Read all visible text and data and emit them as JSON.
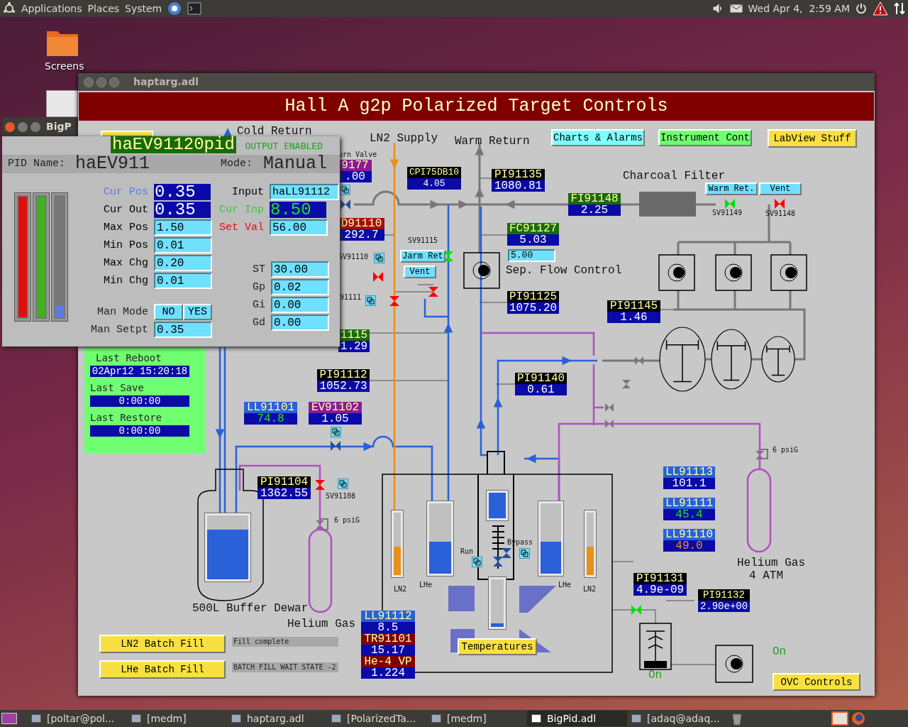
{
  "top_panel": {
    "menus": [
      "Applications",
      "Places",
      "System"
    ],
    "clock": "Wed Apr 4,  2:59 AM"
  },
  "desktop_icons": [
    {
      "label": "Screens"
    }
  ],
  "main_window": {
    "title": "haptarg.adl",
    "banner": "Hall A g2p Polarized Target Controls",
    "nav_buttons": [
      {
        "label": "Charts & Alarms",
        "color": "#80ffff"
      },
      {
        "label": "Instrument Cont",
        "color": "#70ff70"
      },
      {
        "label": "LabView Stuff",
        "color": "#f8e040"
      }
    ],
    "labels": [
      {
        "text": "Cold Return",
        "kind": "caption"
      },
      {
        "text": "LN2 Supply",
        "kind": "caption"
      },
      {
        "text": "Warm Return",
        "kind": "caption"
      },
      {
        "text": "Charcoal Filter",
        "kind": "caption"
      },
      {
        "text": "urn Valve",
        "kind": "tag"
      },
      {
        "text": "SV91115",
        "kind": "tag"
      },
      {
        "text": "SV91110",
        "kind": "tag"
      },
      {
        "text": "91111",
        "kind": "tag"
      },
      {
        "text": "Sep. Flow Control",
        "kind": "caption"
      },
      {
        "text": "SV91149",
        "kind": "tag"
      },
      {
        "text": "SV91148",
        "kind": "tag"
      },
      {
        "text": "SV91108",
        "kind": "tag"
      },
      {
        "text": "6 psiG",
        "kind": "tag"
      },
      {
        "text": "6 psiG",
        "kind": "tag"
      },
      {
        "text": "500L Buffer Dewar",
        "kind": "caption"
      },
      {
        "text": "Helium Gas",
        "kind": "caption"
      },
      {
        "text": "Run",
        "kind": "tag"
      },
      {
        "text": "Bypass",
        "kind": "tag"
      },
      {
        "text": "LN2",
        "kind": "tag"
      },
      {
        "text": "LHe",
        "kind": "tag"
      },
      {
        "text": "LHe",
        "kind": "tag"
      },
      {
        "text": "LN2",
        "kind": "tag"
      },
      {
        "text": "Helium Gas",
        "kind": "caption"
      },
      {
        "text": "4 ATM",
        "kind": "caption"
      },
      {
        "text": "On",
        "kind": "status"
      },
      {
        "text": "On",
        "kind": "status"
      }
    ],
    "readouts": [
      {
        "tag": "9177",
        "value": ".00",
        "color": "#8a1a98",
        "kind": "plain"
      },
      {
        "tag": "CPI75DB10",
        "value": "4.05",
        "color": "#000000",
        "kind": "plain"
      },
      {
        "tag": "PI91135",
        "value": "1080.81",
        "color": "#000000",
        "kind": "plain"
      },
      {
        "tag": "FI91148",
        "value": "2.25",
        "color": "#1a6a0a",
        "kind": "plain"
      },
      {
        "tag": "D91110",
        "value": "292.7",
        "color": "#a01010",
        "kind": "plain"
      },
      {
        "tag": "FC91127",
        "value": "5.03",
        "color": "#1a6a0a",
        "kind": "plain"
      },
      {
        "tag": "PI91125",
        "value": "1075.20",
        "color": "#000000",
        "kind": "plain"
      },
      {
        "tag": "PI91145",
        "value": "1.46",
        "color": "#000000",
        "kind": "plain"
      },
      {
        "tag": "1115",
        "value": "1.29",
        "color": "#1a6a0a",
        "kind": "plain"
      },
      {
        "tag": "PI91112",
        "value": "1052.73",
        "color": "#000000",
        "kind": "plain"
      },
      {
        "tag": "PI91140",
        "value": "0.61",
        "color": "#000000",
        "kind": "plain"
      },
      {
        "tag": "LL91101",
        "value": "74.8",
        "color": "#2a60d8",
        "kind": "ok"
      },
      {
        "tag": "EV91102",
        "value": "1.05",
        "color": "#8a1a98",
        "kind": "plain"
      },
      {
        "tag": "PI91104",
        "value": "1362.55",
        "color": "#000000",
        "kind": "plain"
      },
      {
        "tag": "LL91113",
        "value": "101.1",
        "color": "#2a60d8",
        "kind": "plain"
      },
      {
        "tag": "LL91111",
        "value": "45.4",
        "color": "#2a60d8",
        "kind": "ok"
      },
      {
        "tag": "LL91110",
        "value": "49.0",
        "color": "#2a60d8",
        "kind": "warn"
      },
      {
        "tag": "PI91131",
        "value": "4.9e-09",
        "color": "#000000",
        "kind": "plain"
      },
      {
        "tag": "PI91132",
        "value": "2.90e+00",
        "color": "#000000",
        "kind": "plain"
      },
      {
        "tag": "LL91112",
        "value": "8.5",
        "color": "#2a60d8",
        "kind": "plain"
      },
      {
        "tag": "TR91101",
        "value": "15.17",
        "color": "#800000",
        "kind": "plain"
      },
      {
        "tag": "He-4 VP",
        "value": "1.224",
        "color": "#800000",
        "kind": "plain"
      }
    ],
    "setpoints": [
      {
        "value": "5.00"
      }
    ],
    "buttons": [
      {
        "label": "Warm Ret.",
        "color": "#70e0ff"
      },
      {
        "label": "Vent",
        "color": "#70e0ff"
      },
      {
        "label": "Jarm Ret",
        "color": "#70e0ff"
      },
      {
        "label": "Vent",
        "color": "#70e0ff"
      },
      {
        "label": "Temperatures",
        "color": "#f8e040"
      },
      {
        "label": "OVC Controls",
        "color": "#f8e040"
      },
      {
        "label": "LN2 Batch Fill",
        "color": "#f8e040"
      },
      {
        "label": "LHe Batch Fill",
        "color": "#f8e040"
      }
    ],
    "batch_status": [
      "Fill complete",
      "BATCH FILL WAIT STATE -2"
    ],
    "timestamps": [
      {
        "label": "Last Reboot",
        "value": "02Apr12 15:20:18"
      },
      {
        "label": "Last Save",
        "value": "0:00:00"
      },
      {
        "label": "Last Restore",
        "value": "0:00:00"
      }
    ],
    "vessels": [
      {
        "level": 0.78,
        "color": "#2a60d8"
      },
      {
        "level": 0.45,
        "color": "#e89018"
      },
      {
        "level": 0.45,
        "color": "#2a60d8"
      },
      {
        "level": 1,
        "color": "#2a60d8"
      },
      {
        "level": 0.08,
        "color": "#2a60d8"
      },
      {
        "level": 0.45,
        "color": "#2a60d8"
      },
      {
        "level": 0.45,
        "color": "#e89018"
      }
    ],
    "valves": [
      {
        "color": "#2050a0"
      },
      {
        "color": "#ff0000"
      },
      {
        "color": "#00e000"
      },
      {
        "color": "#ff0000"
      },
      {
        "color": "#ff0000"
      },
      {
        "color": "#00e000"
      },
      {
        "color": "#ff0000"
      },
      {
        "color": "#2050a0"
      },
      {
        "color": "#ff0000"
      },
      {
        "color": "#2050a0"
      },
      {
        "color": "#2050a0"
      },
      {
        "color": "#00e000"
      }
    ]
  },
  "pid_window": {
    "title": "BigP",
    "record": "haEV91120pid",
    "output_status": "OUTPUT ENABLED",
    "name_label": "PID Name:",
    "name": "haEV911",
    "mode_label": "Mode:",
    "mode": "Manual",
    "bars": [
      {
        "color": "#e01010",
        "level": 1
      },
      {
        "color": "#40b020",
        "level": 1
      },
      {
        "color": "#5a7de0",
        "level": 0.12
      }
    ],
    "left_fields": [
      {
        "label": "Cur Pos",
        "value": "0.35",
        "kind": "readout",
        "color": "#5a7de0",
        "ok": false
      },
      {
        "label": "Cur Out",
        "value": "0.35",
        "kind": "readout",
        "color": "#000000",
        "ok": false
      },
      {
        "label": "Max Pos",
        "value": "1.50",
        "kind": "input",
        "color": "#000000"
      },
      {
        "label": "Min Pos",
        "value": "0.01",
        "kind": "input",
        "color": "#000000"
      },
      {
        "label": "Max Chg",
        "value": "0.20",
        "kind": "input",
        "color": "#000000"
      },
      {
        "label": "Min Chg",
        "value": "0.01",
        "kind": "input",
        "color": "#000000"
      }
    ],
    "right_fields": [
      {
        "label": "Input",
        "value": "haLL91112",
        "kind": "input",
        "color": "#000000"
      },
      {
        "label": "Cur Inp",
        "value": "8.50",
        "kind": "readout",
        "color": "#40c040",
        "ok": true
      },
      {
        "label": "Set Val",
        "value": "56.00",
        "kind": "input",
        "color": "#e01010"
      }
    ],
    "gain_fields": [
      {
        "label": "ST",
        "value": "30.00"
      },
      {
        "label": "Gp",
        "value": "0.02"
      },
      {
        "label": "Gi",
        "value": "0.00"
      },
      {
        "label": "Gd",
        "value": "0.00"
      }
    ],
    "man_mode": {
      "label": "Man Mode",
      "options": [
        "NO",
        "YES"
      ]
    },
    "man_setpt": {
      "label": "Man Setpt",
      "value": "0.35"
    }
  },
  "taskbar": [
    {
      "label": "[poltar@pol...",
      "selected": false
    },
    {
      "label": "[medm]",
      "selected": false
    },
    {
      "label": "haptarg.adl",
      "selected": false
    },
    {
      "label": "[PolarizedTa...",
      "selected": false
    },
    {
      "label": "[medm]",
      "selected": false
    },
    {
      "label": "BigPid.adl",
      "selected": true
    },
    {
      "label": "[adaq@adaq...",
      "selected": false
    }
  ]
}
